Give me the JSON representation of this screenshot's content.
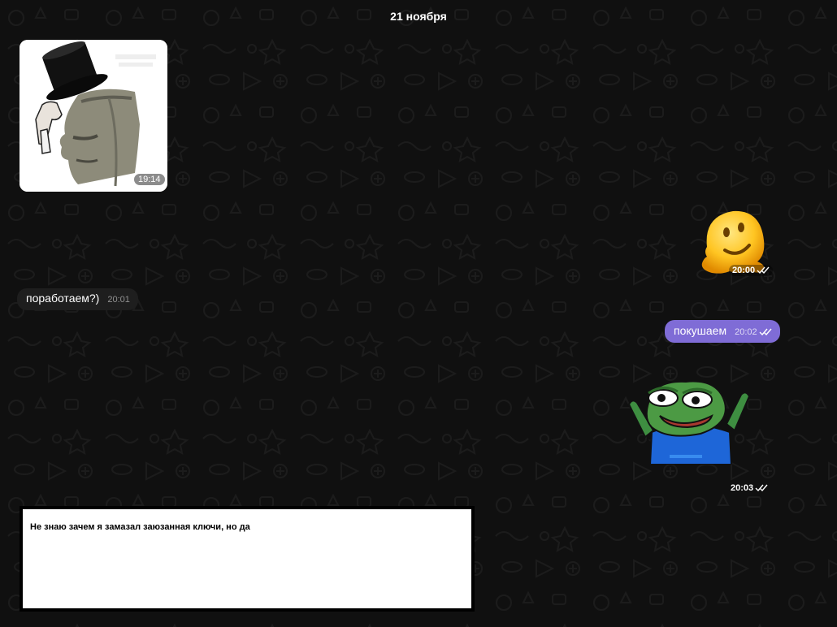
{
  "chat": {
    "date_separator": "21 ноября",
    "messages": [
      {
        "type": "image",
        "direction": "incoming",
        "time": "19:14",
        "image_watermark": "🗿"
      },
      {
        "type": "sticker",
        "direction": "outgoing",
        "time": "20:00",
        "read": true,
        "sticker": "melting-face"
      },
      {
        "type": "text",
        "direction": "incoming",
        "text": "поработаем?)",
        "time": "20:01"
      },
      {
        "type": "text",
        "direction": "outgoing",
        "text": "покушаем",
        "time": "20:02",
        "read": true
      },
      {
        "type": "sticker",
        "direction": "outgoing",
        "time": "20:03",
        "read": true,
        "sticker": "pepe-frog"
      }
    ]
  },
  "annotation": {
    "text": "Не знаю зачем я замазал заюзанная ключи, но да"
  },
  "colors": {
    "background": "#101010",
    "incoming_bubble": "#1e1e1e",
    "outgoing_bubble": "#7f6cd6"
  }
}
